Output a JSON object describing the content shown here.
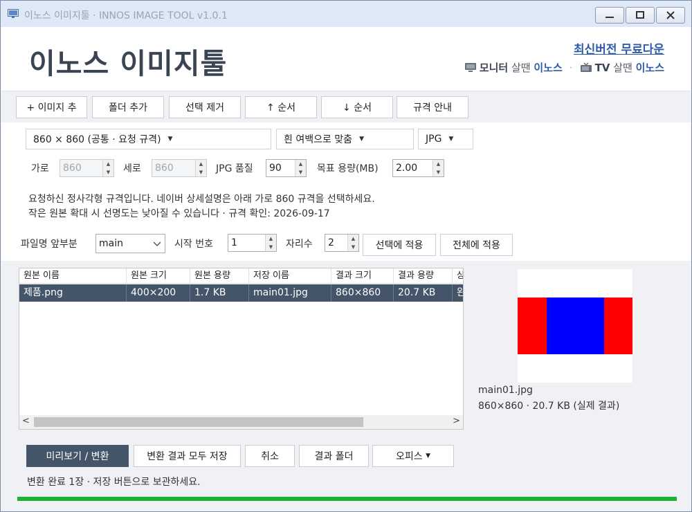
{
  "window": {
    "title": "이노스 이미지툴 · INNOS IMAGE TOOL v1.0.1",
    "controls": [
      "minimize",
      "maximize",
      "close"
    ]
  },
  "header": {
    "brand": "이노스 이미지툴",
    "update_link": "최신버전 무료다운",
    "promo": {
      "monitor_label": "모니터",
      "monitor_text": "살땐",
      "monitor_brand": "이노스",
      "tv_label": "TV",
      "tv_text": "살땐",
      "tv_brand": "이노스",
      "separator": "·"
    }
  },
  "toolbar": {
    "add_image": "+ 이미지 추",
    "add_folder": "폴더 추가",
    "remove_selected": "선택 제거",
    "move_up": "↑ 순서",
    "move_down": "↓ 순서",
    "spec_guide": "규격 안내"
  },
  "settings": {
    "size_preset": "860 × 860 (공통 · 요청 규격)",
    "fit_mode": "흰 여백으로 맞춤",
    "format": "JPG",
    "width_label": "가로",
    "width_value": "860",
    "height_label": "세로",
    "height_value": "860",
    "quality_label": "JPG 품질",
    "quality_value": "90",
    "target_size_label": "목표 용량(MB)",
    "target_size_value": "2.00",
    "note_line1": "요청하신 정사각형 규격입니다. 네이버 상세설명은 아래 가로 860 규격을 선택하세요.",
    "note_line2": "작은 원본 확대 시 선명도는 낮아질 수 있습니다 · 규격 확인: 2026-09-17"
  },
  "filename": {
    "prefix_label": "파일명 앞부분",
    "prefix_value": "main",
    "start_label": "시작 번호",
    "start_value": "1",
    "digits_label": "자리수",
    "digits_value": "2",
    "apply_selected": "선택에 적용",
    "apply_all": "전체에 적용"
  },
  "table": {
    "columns": [
      "원본 이름",
      "원본 크기",
      "원본 용량",
      "저장 이름",
      "결과 크기",
      "결과 용량",
      "상"
    ],
    "rows": [
      [
        "제품.png",
        "400×200",
        "1.7 KB",
        "main01.jpg",
        "860×860",
        "20.7 KB",
        "완"
      ]
    ]
  },
  "preview": {
    "filename": "main01.jpg",
    "info": "860×860 · 20.7 KB (실제 결과)",
    "colors": {
      "left": "#ff0000",
      "center": "#0000ff",
      "right": "#ff0000",
      "background": "#ffffff"
    }
  },
  "actions": {
    "preview_convert": "미리보기 / 변환",
    "save_all": "변환 결과 모두 저장",
    "cancel": "취소",
    "result_folder": "결과 폴더",
    "office": "오피스"
  },
  "status": {
    "message": "변환 완료 1장 · 저장 버튼으로 보관하세요.",
    "progress": 1.0
  },
  "colors": {
    "accent": "#445469",
    "link": "#2f5aa8",
    "progress": "#1eb030"
  }
}
